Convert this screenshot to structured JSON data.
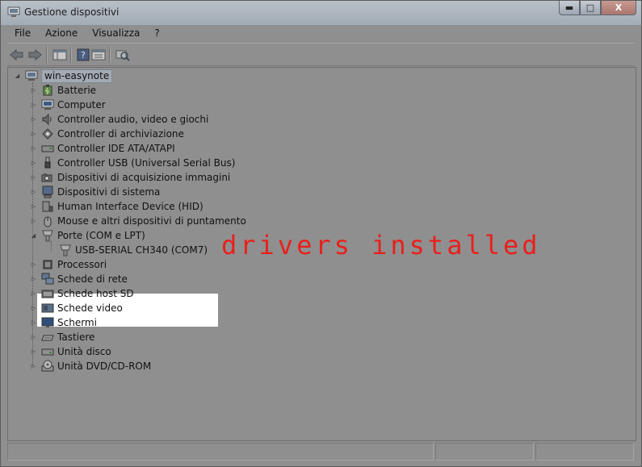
{
  "window": {
    "title": "Gestione dispositivi",
    "buttons": {
      "minimize": "▬",
      "maximize": "□",
      "close": "X"
    }
  },
  "menu": [
    "File",
    "Azione",
    "Visualizza",
    "?"
  ],
  "tree": {
    "root": "win-easynote",
    "categories": [
      {
        "label": "Batterie",
        "icon": "battery-icon"
      },
      {
        "label": "Computer",
        "icon": "computer-icon"
      },
      {
        "label": "Controller audio, video e giochi",
        "icon": "speaker-icon"
      },
      {
        "label": "Controller di archiviazione",
        "icon": "storage-controller-icon"
      },
      {
        "label": "Controller IDE ATA/ATAPI",
        "icon": "ide-icon"
      },
      {
        "label": "Controller USB (Universal Serial Bus)",
        "icon": "usb-icon"
      },
      {
        "label": "Dispositivi di acquisizione immagini",
        "icon": "camera-icon"
      },
      {
        "label": "Dispositivi di sistema",
        "icon": "system-device-icon"
      },
      {
        "label": "Human Interface Device (HID)",
        "icon": "hid-icon"
      },
      {
        "label": "Mouse e altri dispositivi di puntamento",
        "icon": "mouse-icon"
      },
      {
        "label": "Porte (COM e LPT)",
        "icon": "port-icon",
        "expanded": true,
        "children": [
          {
            "label": "USB-SERIAL CH340 (COM7)",
            "icon": "port-icon"
          }
        ]
      },
      {
        "label": "Processori",
        "icon": "processor-icon"
      },
      {
        "label": "Schede di rete",
        "icon": "network-icon"
      },
      {
        "label": "Schede host SD",
        "icon": "sd-icon"
      },
      {
        "label": "Schede video",
        "icon": "display-adapter-icon"
      },
      {
        "label": "Schermi",
        "icon": "monitor-icon"
      },
      {
        "label": "Tastiere",
        "icon": "keyboard-icon"
      },
      {
        "label": "Unità disco",
        "icon": "disk-icon"
      },
      {
        "label": "Unità DVD/CD-ROM",
        "icon": "dvd-icon"
      }
    ]
  },
  "annotation": "drivers installed"
}
